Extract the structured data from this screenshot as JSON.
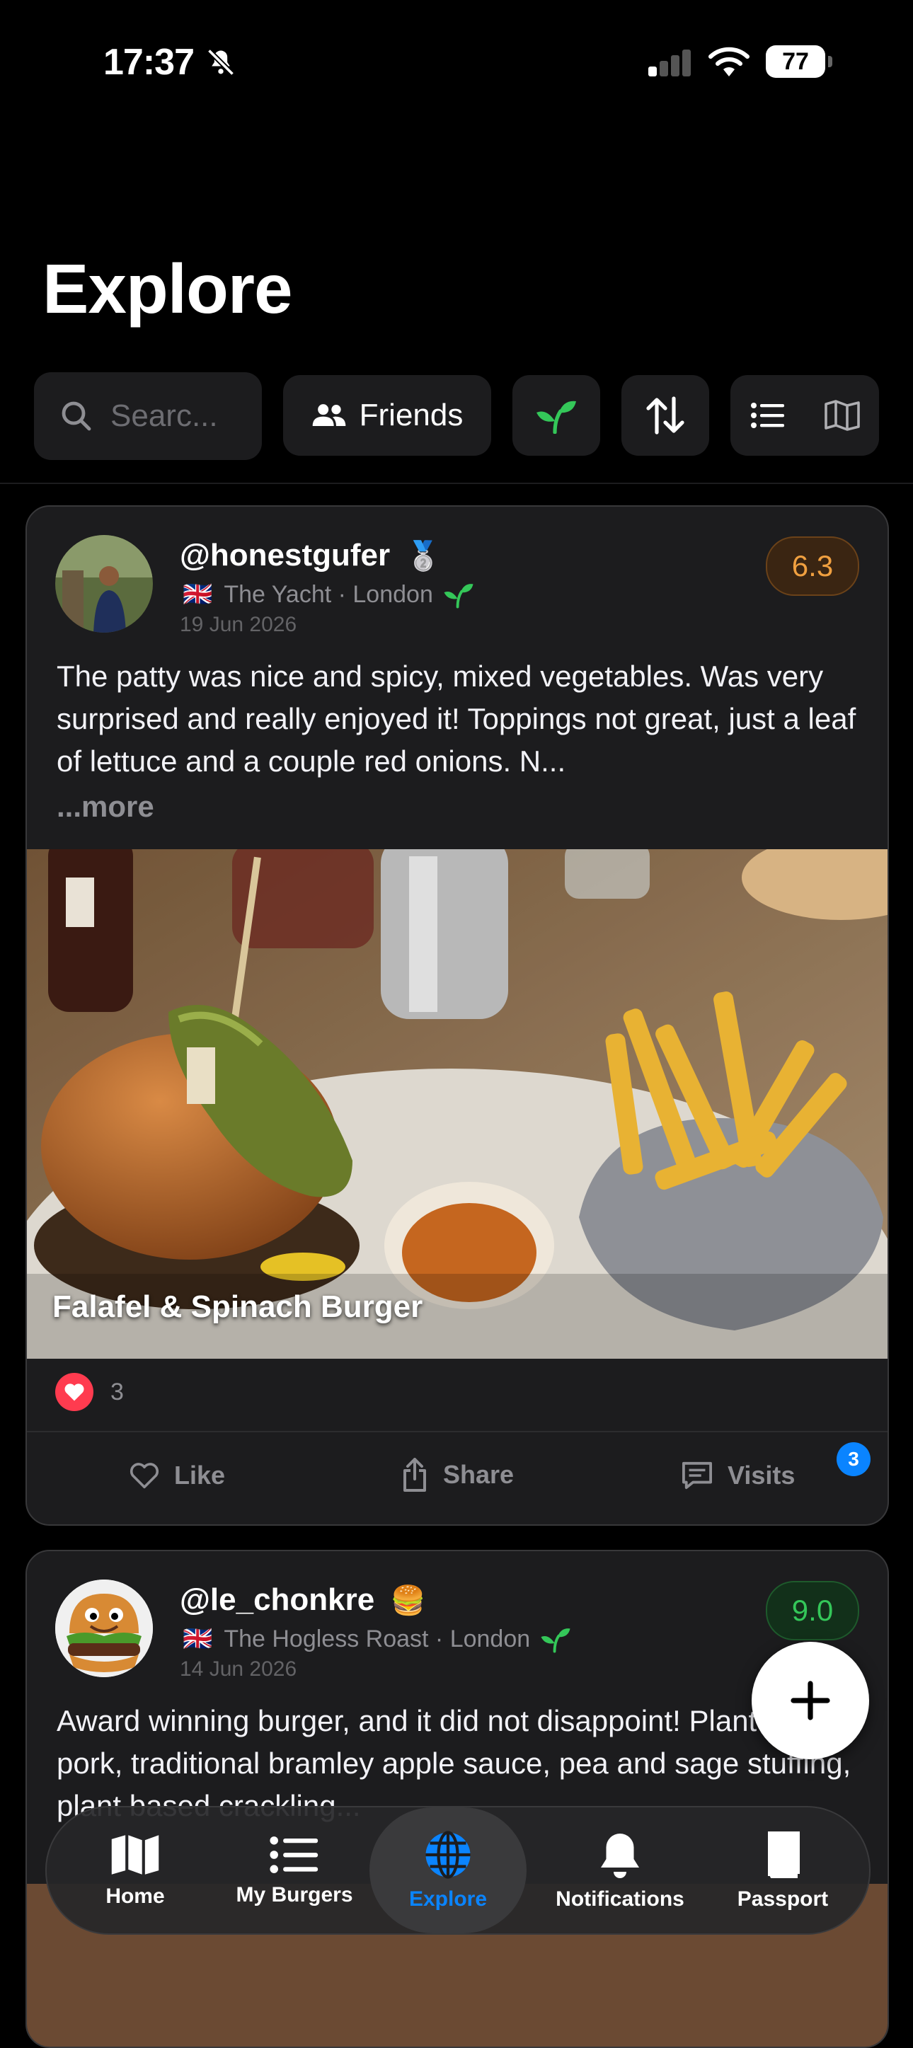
{
  "status_bar": {
    "time": "17:37",
    "battery": "77"
  },
  "header": {
    "title": "Explore"
  },
  "filters": {
    "search_placeholder": "Searc...",
    "friends_label": "Friends"
  },
  "posts": [
    {
      "username": "@honestgufer",
      "badge_emoji": "🥈",
      "flag": "🇬🇧",
      "place": "The Yacht · London",
      "date": "19 Jun 2026",
      "score": "6.3",
      "review": "The patty was nice and spicy, mixed vegetables. Was very surprised and really enjoyed it! Toppings not great, just a leaf of lettuce and a couple red onions. N...",
      "more_label": "...more",
      "burger_name": "Falafel & Spinach Burger",
      "likes": "3",
      "visits_badge": "3"
    },
    {
      "username": "@le_chonkre",
      "badge_emoji": "🍔",
      "flag": "🇬🇧",
      "place": "The Hogless Roast · London",
      "date": "14 Jun 2026",
      "score": "9.0",
      "review": "Award winning burger, and it did not disappoint! Plant based pork, traditional bramley apple sauce, pea and sage stuffing, plant based crackling..."
    }
  ],
  "actions": {
    "like": "Like",
    "share": "Share",
    "visits": "Visits"
  },
  "tabbar": {
    "items": [
      {
        "label": "Home",
        "icon": "map-icon"
      },
      {
        "label": "My Burgers",
        "icon": "list-icon"
      },
      {
        "label": "Explore",
        "icon": "globe-icon"
      },
      {
        "label": "Notifications",
        "icon": "bell-icon"
      },
      {
        "label": "Passport",
        "icon": "book-icon"
      }
    ],
    "active": "Explore"
  },
  "colors": {
    "accent": "#0a84ff",
    "score_orange": "#f0a040",
    "score_green": "#34c759",
    "veg_green": "#34c759"
  }
}
